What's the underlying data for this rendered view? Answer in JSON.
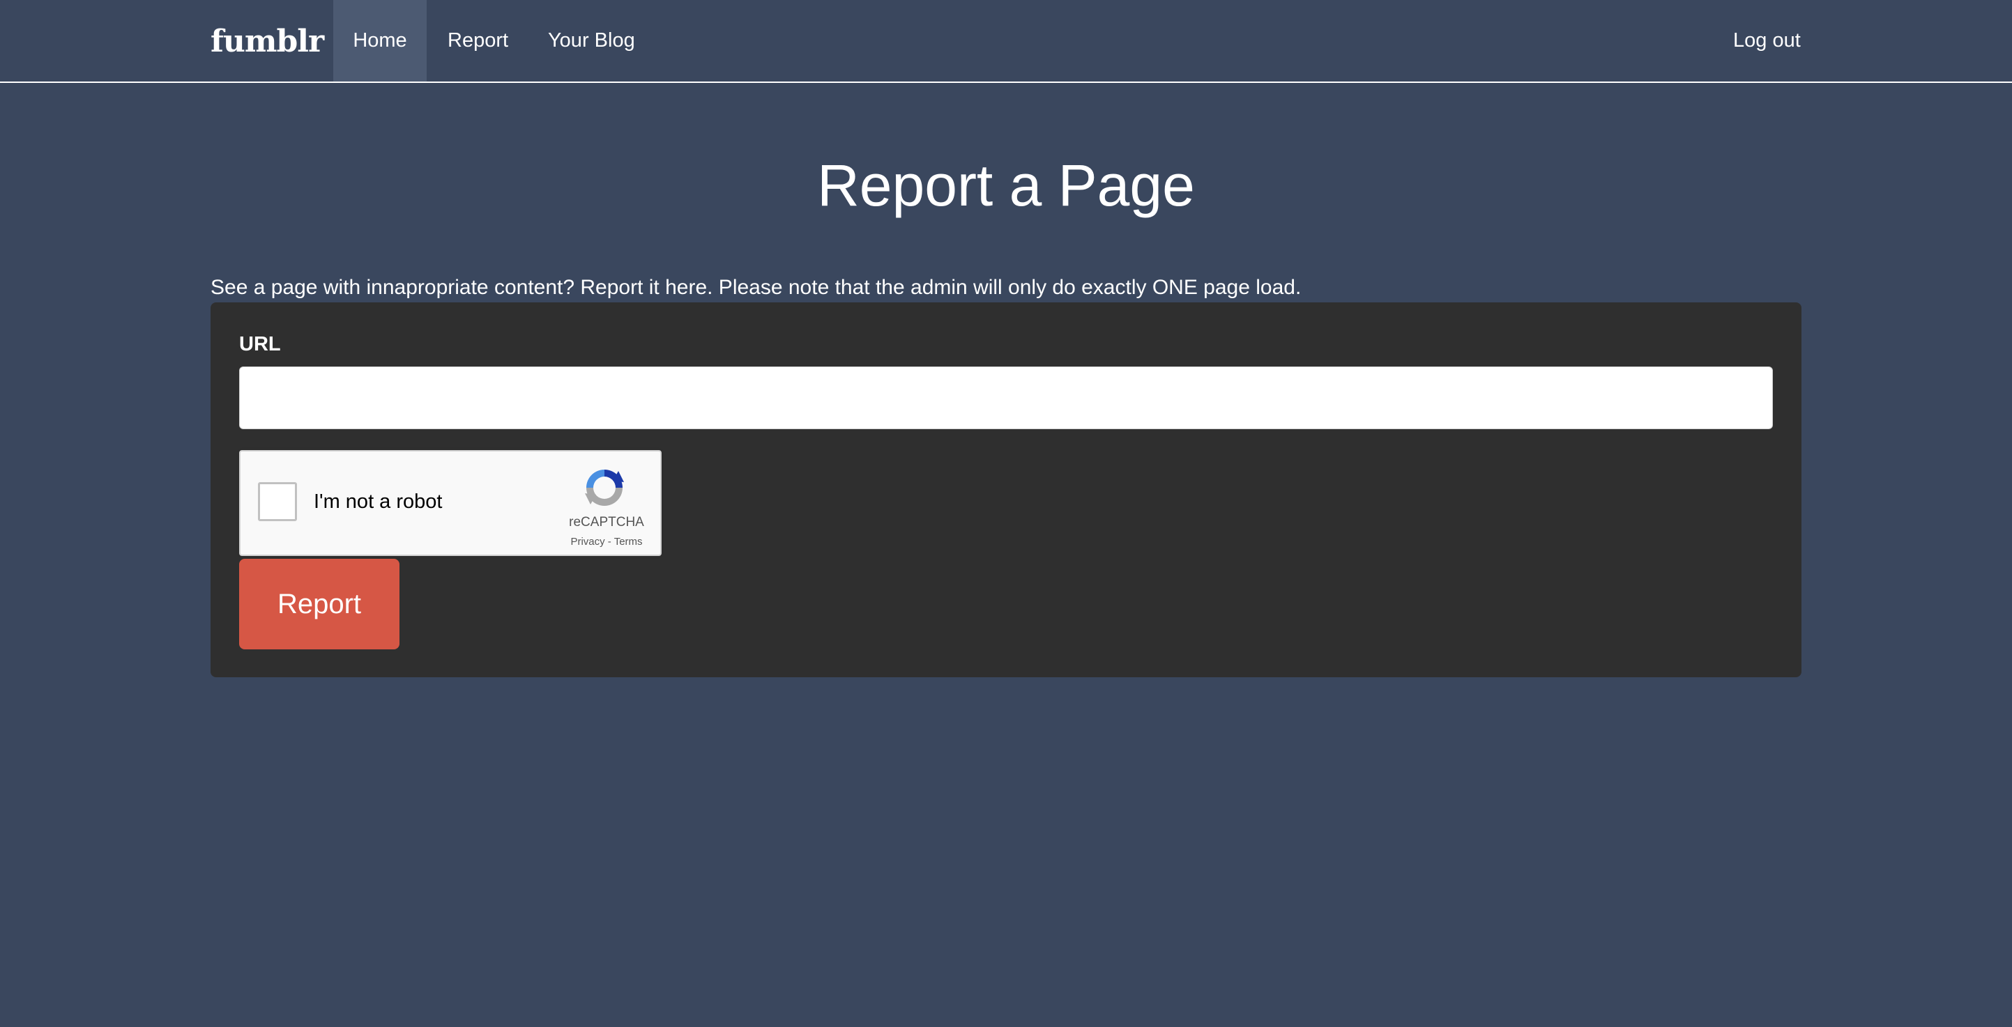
{
  "navbar": {
    "brand": "fumblr",
    "items": [
      {
        "label": "Home",
        "active": true
      },
      {
        "label": "Report",
        "active": false
      },
      {
        "label": "Your Blog",
        "active": false
      }
    ],
    "logout_label": "Log out"
  },
  "main": {
    "title": "Report a Page",
    "intro": "See a page with innapropriate content? Report it here. Please note that the admin will only do exactly ONE page load.",
    "form": {
      "url_label": "URL",
      "url_value": "",
      "url_placeholder": "",
      "captcha": {
        "label": "I'm not a robot",
        "brand": "reCAPTCHA",
        "privacy_label": "Privacy",
        "separator": " - ",
        "terms_label": "Terms",
        "checked": false
      },
      "submit_label": "Report"
    }
  },
  "colors": {
    "background": "#3a475e",
    "nav_active": "#4c5a72",
    "card": "#2f2f2f",
    "button": "#d65745"
  },
  "icons": {
    "captcha_logo": "recaptcha-logo-icon"
  }
}
